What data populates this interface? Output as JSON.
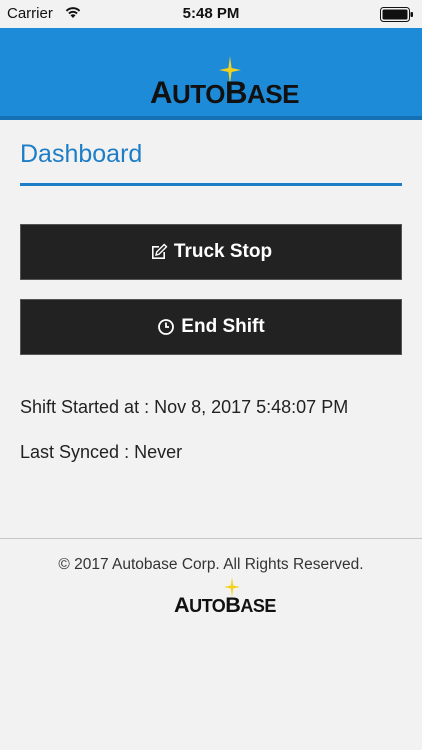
{
  "status_bar": {
    "carrier": "Carrier",
    "time": "5:48 PM",
    "wifi_icon": "wifi-icon",
    "battery_icon": "battery-full-icon"
  },
  "header": {
    "logo_text_a": "A",
    "logo_text_b": "UTO",
    "logo_text_c": "B",
    "logo_text_d": "ASE",
    "brand_color": "#1d8bd8",
    "star_color": "#f2d21b"
  },
  "page": {
    "title": "Dashboard",
    "accent_color": "#1d7ec7"
  },
  "buttons": {
    "truck_stop_label": "Truck Stop",
    "truck_stop_icon": "edit-icon",
    "end_shift_label": "End Shift",
    "end_shift_icon": "clock-icon"
  },
  "info": {
    "shift_started": "Shift Started at : Nov 8, 2017 5:48:07 PM",
    "last_synced": "Last Synced : Never"
  },
  "footer": {
    "copyright": "© 2017 Autobase Corp. All Rights Reserved.",
    "logo_text_a": "A",
    "logo_text_b": "UTO",
    "logo_text_c": "B",
    "logo_text_d": "ASE"
  }
}
